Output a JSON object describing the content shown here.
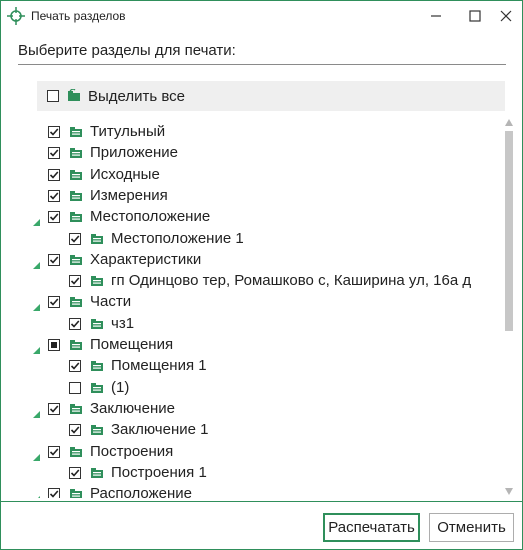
{
  "window": {
    "title": "Печать разделов"
  },
  "prompt": "Выберите разделы для печати:",
  "select_all": {
    "label": "Выделить все",
    "checked": false
  },
  "tree": [
    {
      "label": "Титульный",
      "level": 0,
      "state": "checked",
      "expander": false
    },
    {
      "label": "Приложение",
      "level": 0,
      "state": "checked",
      "expander": false
    },
    {
      "label": "Исходные",
      "level": 0,
      "state": "checked",
      "expander": false
    },
    {
      "label": "Измерения",
      "level": 0,
      "state": "checked",
      "expander": false
    },
    {
      "label": "Местоположение",
      "level": 0,
      "state": "checked",
      "expander": true
    },
    {
      "label": "Местоположение 1",
      "level": 1,
      "state": "checked",
      "expander": false
    },
    {
      "label": "Характеристики",
      "level": 0,
      "state": "checked",
      "expander": true
    },
    {
      "label": "гп Одинцово тер, Ромашково с, Каширина ул, 16а д",
      "level": 1,
      "state": "checked",
      "expander": false
    },
    {
      "label": "Части",
      "level": 0,
      "state": "checked",
      "expander": true
    },
    {
      "label": "чз1",
      "level": 1,
      "state": "checked",
      "expander": false
    },
    {
      "label": "Помещения",
      "level": 0,
      "state": "partial",
      "expander": true
    },
    {
      "label": "Помещения 1",
      "level": 1,
      "state": "checked",
      "expander": false
    },
    {
      "label": " (1)",
      "level": 1,
      "state": "unchecked",
      "expander": false
    },
    {
      "label": "Заключение",
      "level": 0,
      "state": "checked",
      "expander": true
    },
    {
      "label": "Заключение 1",
      "level": 1,
      "state": "checked",
      "expander": false
    },
    {
      "label": "Построения",
      "level": 0,
      "state": "checked",
      "expander": true
    },
    {
      "label": "Построения 1",
      "level": 1,
      "state": "checked",
      "expander": false
    },
    {
      "label": "Расположение",
      "level": 0,
      "state": "checked",
      "expander": true
    }
  ],
  "buttons": {
    "print": "Распечатать",
    "cancel": "Отменить"
  },
  "colors": {
    "accent": "#2f8f5b",
    "folder": "#2f8f5b",
    "expander": "#3aa86a"
  },
  "icons": {
    "app": "crosshair-icon",
    "minimize": "minimize-icon",
    "maximize": "maximize-icon",
    "close": "close-icon",
    "folder": "folder-icon"
  }
}
